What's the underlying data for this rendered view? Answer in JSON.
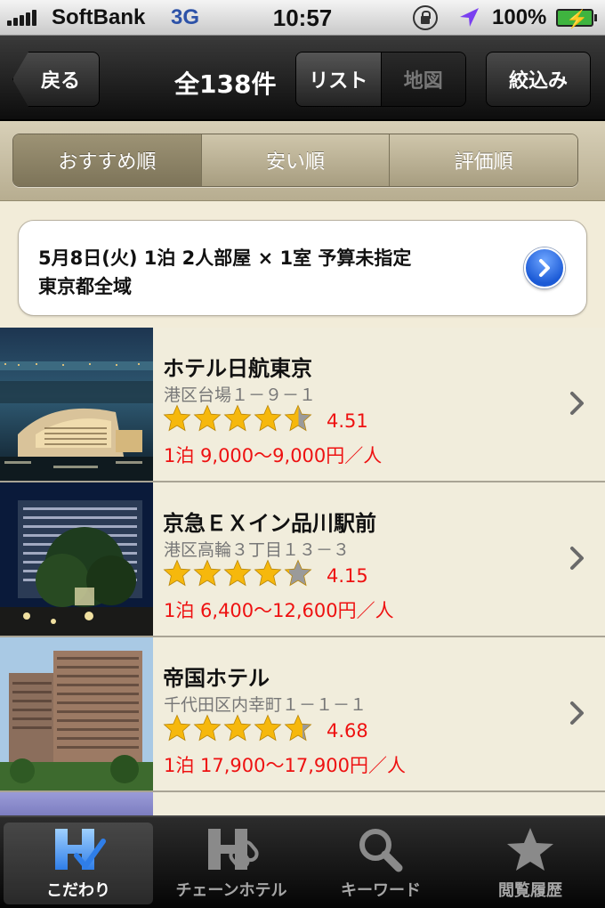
{
  "status_bar": {
    "carrier": "SoftBank",
    "network": "3G",
    "time": "10:57",
    "battery": "100%"
  },
  "nav": {
    "back_label": "戻る",
    "title": "全138件",
    "segments": [
      "リスト",
      "地図"
    ],
    "filter_label": "絞込み"
  },
  "sort": {
    "options": [
      "おすすめ順",
      "安い順",
      "評価順"
    ],
    "active_index": 0
  },
  "conditions": {
    "line1": "5月8日(火)  1泊  2人部屋 × 1室  予算未指定",
    "line2": "東京都全域"
  },
  "hotels": [
    {
      "name": "ホテル日航東京",
      "address": "港区台場１－９－１",
      "rating": "4.51",
      "rating_value": 4.51,
      "price": "1泊 9,000〜9,000円／人"
    },
    {
      "name": "京急ＥＸイン品川駅前",
      "address": "港区高輪３丁目１３－３",
      "rating": "4.15",
      "rating_value": 4.15,
      "price": "1泊 6,400〜12,600円／人"
    },
    {
      "name": "帝国ホテル",
      "address": "千代田区内幸町１－１－１",
      "rating": "4.68",
      "rating_value": 4.68,
      "price": "1泊 17,900〜17,900円／人"
    }
  ],
  "tabs": [
    {
      "label": "こだわり",
      "icon": "hotel-check-icon"
    },
    {
      "label": "チェーンホテル",
      "icon": "hotel-chain-icon"
    },
    {
      "label": "キーワード",
      "icon": "search-icon"
    },
    {
      "label": "閲覧履歴",
      "icon": "star-icon"
    }
  ],
  "colors": {
    "price_red": "#e11111",
    "star_gold": "#f6b80c",
    "background": "#f2ecd9",
    "accent_blue": "#1b5ad6"
  }
}
